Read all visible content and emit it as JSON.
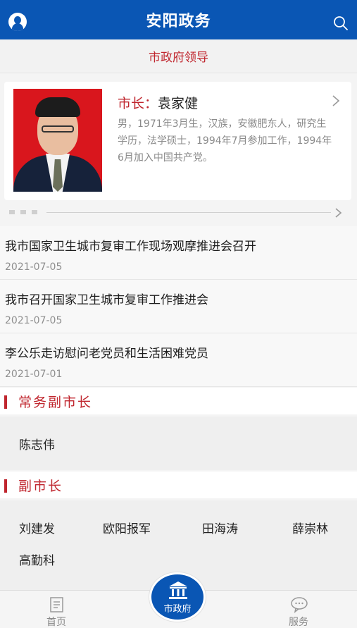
{
  "header": {
    "title": "安阳政务",
    "user_icon": "user-icon",
    "search_icon": "search-icon"
  },
  "subheader": {
    "title": "市政府领导"
  },
  "mayor": {
    "role": "市长：",
    "name": "袁家健",
    "bio": "男，1971年3月生，汉族，安徽肥东人，研究生学历，法学硕士，1994年7月参加工作，1994年6月加入中国共产党。"
  },
  "news": [
    {
      "title": "我市国家卫生城市复审工作现场观摩推进会召开",
      "date": "2021-07-05"
    },
    {
      "title": "我市召开国家卫生城市复审工作推进会",
      "date": "2021-07-05"
    },
    {
      "title": "李公乐走访慰问老党员和生活困难党员",
      "date": "2021-07-01"
    }
  ],
  "executive_vice": {
    "label": "常务副市长",
    "people": [
      "陈志伟"
    ]
  },
  "vice": {
    "label": "副市长",
    "people": [
      "刘建发",
      "欧阳报军",
      "田海涛",
      "薛崇林",
      "高勤科"
    ]
  },
  "tabbar": {
    "home": "首页",
    "government": "市政府",
    "service": "服务"
  },
  "colors": {
    "brand_blue": "#0a56b4",
    "accent_red": "#c0262e"
  }
}
